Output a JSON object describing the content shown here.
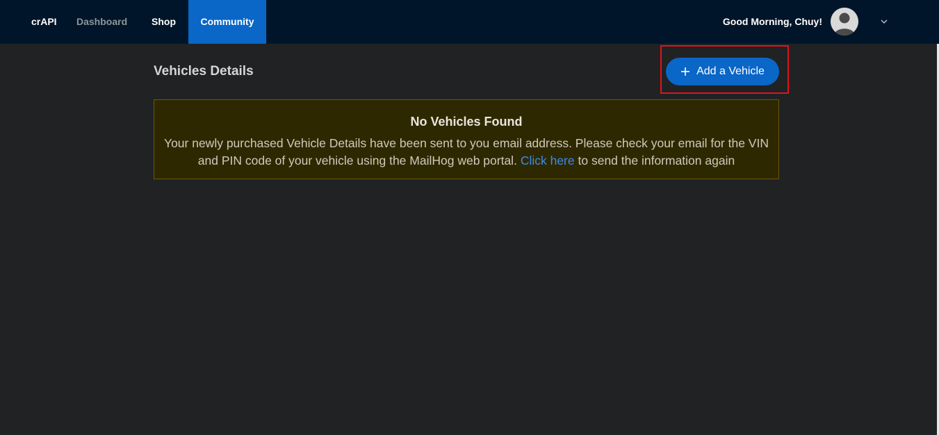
{
  "header": {
    "brand": "crAPI",
    "nav": {
      "dashboard": "Dashboard",
      "shop": "Shop",
      "community": "Community"
    },
    "greeting": "Good Morning, Chuy!",
    "active_tab_color": "#0a66c7"
  },
  "main": {
    "title": "Vehicles Details",
    "add_button_label": "Add a Vehicle",
    "alert": {
      "title": "No Vehicles Found",
      "text_before": "Your newly purchased Vehicle Details have been sent to you email address. Please check your email for the VIN and PIN code of your vehicle using the MailHog web portal.",
      "link": "Click here",
      "text_after": "to send the information again"
    }
  },
  "icons": {
    "avatar": "user-avatar-icon",
    "chevron": "chevron-down-icon",
    "plus": "plus-icon"
  }
}
